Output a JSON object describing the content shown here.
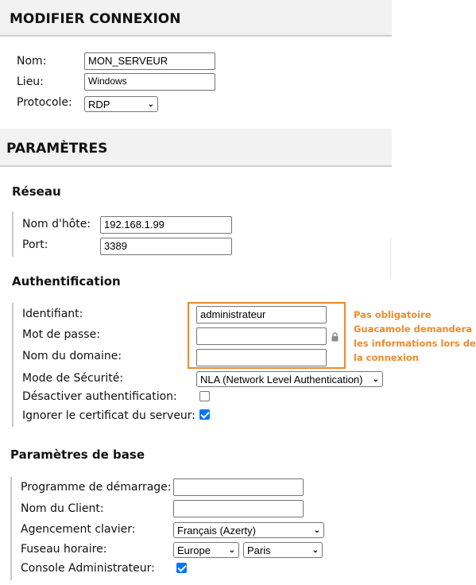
{
  "edit_connection": {
    "title": "MODIFIER CONNEXION",
    "name_label": "Nom:",
    "name_value": "MON_SERVEUR",
    "location_label": "Lieu:",
    "location_value": "Windows",
    "protocol_label": "Protocole:",
    "protocol_value": "RDP"
  },
  "parameters": {
    "title": "PARAMÈTRES",
    "network": {
      "title": "Réseau",
      "hostname_label": "Nom d'hôte:",
      "hostname_value": "192.168.1.99",
      "port_label": "Port:",
      "port_value": "3389"
    },
    "auth": {
      "title": "Authentification",
      "username_label": "Identifiant:",
      "username_value": "administrateur",
      "password_label": "Mot de passe:",
      "password_value": "",
      "domain_label": "Nom du domaine:",
      "domain_value": "",
      "security_label": "Mode de Sécurité:",
      "security_value": "NLA (Network Level Authentication)",
      "disable_auth_label": "Désactiver authentification:",
      "disable_auth_checked": false,
      "ignore_cert_label": "Ignorer le certificat du serveur:",
      "ignore_cert_checked": true,
      "note_lines": [
        "Pas obligatoire",
        "Guacamole demandera",
        "les informations lors de",
        "la connexion"
      ],
      "note_color": "#f08a2a"
    },
    "basic": {
      "title": "Paramètres de base",
      "startup_program_label": "Programme de démarrage:",
      "startup_program_value": "",
      "client_name_label": "Nom du Client:",
      "client_name_value": "",
      "keyboard_label": "Agencement clavier:",
      "keyboard_value": "Français (Azerty)",
      "timezone_label": "Fuseau horaire:",
      "timezone_region": "Europe",
      "timezone_city": "Paris",
      "admin_console_label": "Console Administrateur:",
      "admin_console_checked": true
    }
  },
  "colors": {
    "accent": "#0075ff",
    "header_bg": "#f2f2f2"
  }
}
